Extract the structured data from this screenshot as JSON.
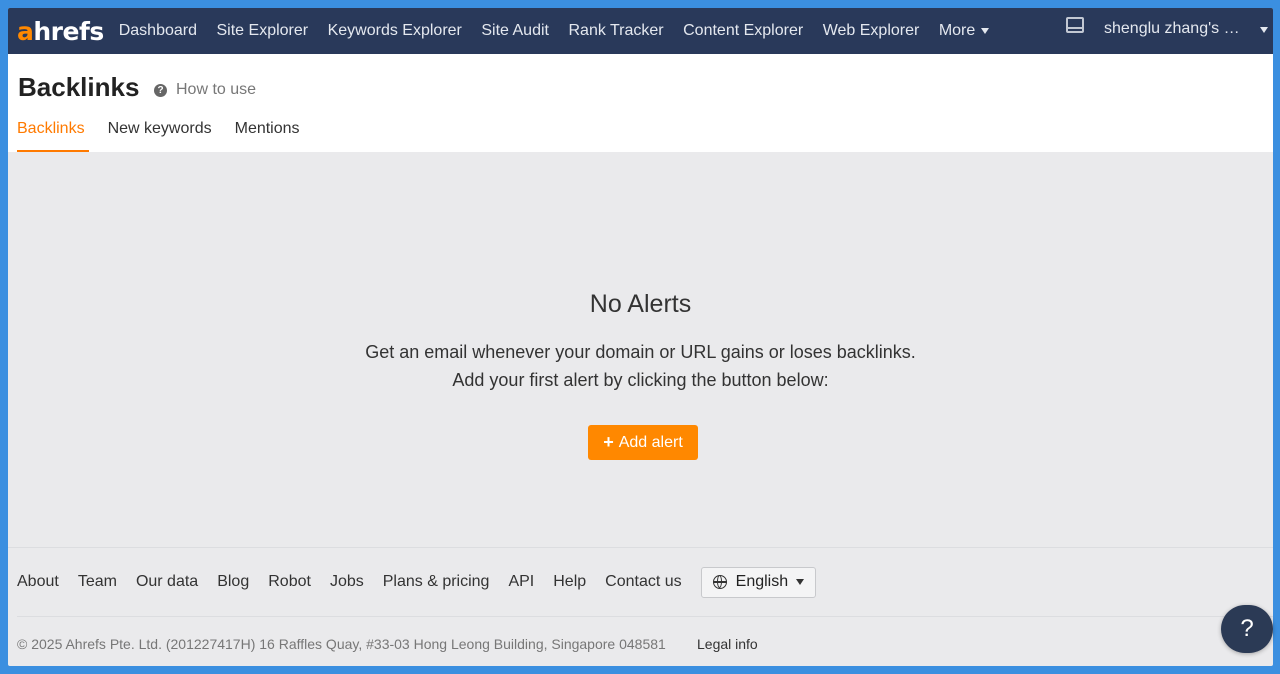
{
  "nav": {
    "logo_a": "a",
    "logo_rest": "hrefs",
    "items": [
      "Dashboard",
      "Site Explorer",
      "Keywords Explorer",
      "Site Audit",
      "Rank Tracker",
      "Content Explorer",
      "Web Explorer"
    ],
    "more_label": "More",
    "account": "shenglu zhang's …"
  },
  "header": {
    "title": "Backlinks",
    "how_to_use": "How to use",
    "tabs": [
      "Backlinks",
      "New keywords",
      "Mentions"
    ],
    "active_tab": "Backlinks"
  },
  "empty_state": {
    "title": "No Alerts",
    "line1": "Get an email whenever your domain or URL gains or loses backlinks.",
    "line2": "Add your first alert by clicking the button below:",
    "button_plus": "+",
    "button_label": "Add alert"
  },
  "footer": {
    "links": [
      "About",
      "Team",
      "Our data",
      "Blog",
      "Robot",
      "Jobs",
      "Plans & pricing",
      "API",
      "Help",
      "Contact us"
    ],
    "language": "English",
    "copyright": "© 2025 Ahrefs Pte. Ltd. (201227417H) 16 Raffles Quay, #33-03 Hong Leong Building, Singapore 048581",
    "legal": "Legal info"
  },
  "help_fab": "?",
  "colors": {
    "accent": "#ff8800",
    "nav_bg": "#29395a",
    "content_bg": "#eaeaec",
    "frame": "#3b8fe0"
  }
}
